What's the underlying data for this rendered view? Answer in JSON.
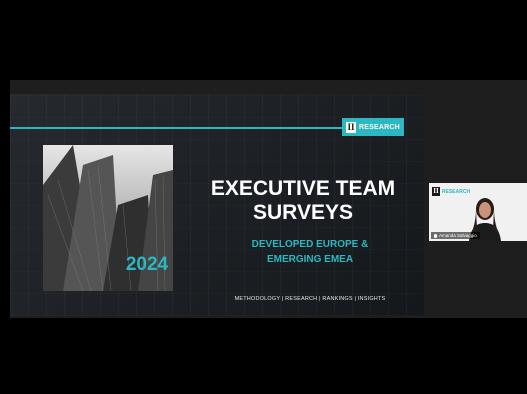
{
  "slide": {
    "logo_text": "RESEARCH",
    "logo_mark": "II",
    "year": "2024",
    "headline_line1": "EXECUTIVE TEAM",
    "headline_line2": "SURVEYS",
    "subheadline_line1": "DEVELOPED EUROPE &",
    "subheadline_line2": "EMERGING EMEA",
    "footer_tags": "METHODOLOGY | RESEARCH | RANKINGS | INSIGHTS",
    "accent_color": "#2bb8c0"
  },
  "webcam": {
    "logo_mark": "II",
    "logo_text": "RESEARCH",
    "name_label": "Amanda Salvaggio"
  }
}
